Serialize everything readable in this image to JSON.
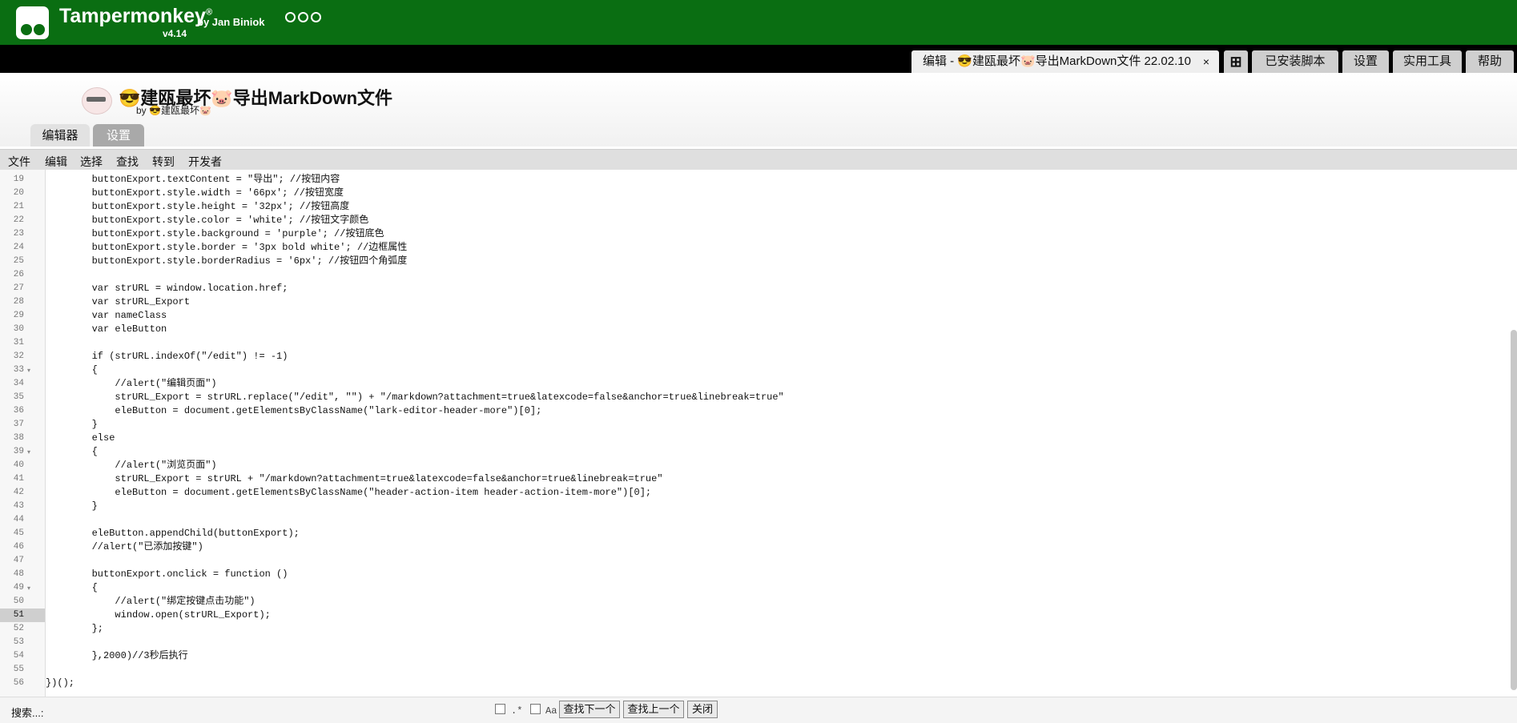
{
  "header": {
    "brand": "Tampermonkey",
    "registered": "®",
    "author": "by Jan Biniok",
    "version": "v4.14"
  },
  "tabs": {
    "editor_tab": "编辑 - 😎建瓯最坏🐷导出MarkDown文件 22.02.10",
    "close": "×",
    "plus": "⊞",
    "installed": "已安装脚本",
    "settings": "设置",
    "utilities": "实用工具",
    "help": "帮助"
  },
  "script": {
    "title": "😎建瓯最坏🐷导出MarkDown文件",
    "author": "by 😎建瓯最坏🐷"
  },
  "subtabs": {
    "editor": "编辑器",
    "settings": "设置"
  },
  "menu": {
    "file": "文件",
    "edit": "编辑",
    "select": "选择",
    "find": "查找",
    "goto": "转到",
    "developer": "开发者"
  },
  "code_lines": [
    {
      "n": 19,
      "text": "        buttonExport.textContent = \"导出\"; //按钮内容"
    },
    {
      "n": 20,
      "text": "        buttonExport.style.width = '66px'; //按钮宽度"
    },
    {
      "n": 21,
      "text": "        buttonExport.style.height = '32px'; //按钮高度"
    },
    {
      "n": 22,
      "text": "        buttonExport.style.color = 'white'; //按钮文字颜色"
    },
    {
      "n": 23,
      "text": "        buttonExport.style.background = 'purple'; //按钮底色"
    },
    {
      "n": 24,
      "text": "        buttonExport.style.border = '3px bold white'; //边框属性"
    },
    {
      "n": 25,
      "text": "        buttonExport.style.borderRadius = '6px'; //按钮四个角弧度"
    },
    {
      "n": 26,
      "text": ""
    },
    {
      "n": 27,
      "text": "        var strURL = window.location.href;"
    },
    {
      "n": 28,
      "text": "        var strURL_Export"
    },
    {
      "n": 29,
      "text": "        var nameClass"
    },
    {
      "n": 30,
      "text": "        var eleButton"
    },
    {
      "n": 31,
      "text": ""
    },
    {
      "n": 32,
      "text": "        if (strURL.indexOf(\"/edit\") != -1)"
    },
    {
      "n": 33,
      "text": "        {",
      "fold": true
    },
    {
      "n": 34,
      "text": "            //alert(\"编辑页面\")"
    },
    {
      "n": 35,
      "text": "            strURL_Export = strURL.replace(\"/edit\", \"\") + \"/markdown?attachment=true&latexcode=false&anchor=true&linebreak=true\""
    },
    {
      "n": 36,
      "text": "            eleButton = document.getElementsByClassName(\"lark-editor-header-more\")[0];"
    },
    {
      "n": 37,
      "text": "        }"
    },
    {
      "n": 38,
      "text": "        else"
    },
    {
      "n": 39,
      "text": "        {",
      "fold": true
    },
    {
      "n": 40,
      "text": "            //alert(\"浏览页面\")"
    },
    {
      "n": 41,
      "text": "            strURL_Export = strURL + \"/markdown?attachment=true&latexcode=false&anchor=true&linebreak=true\""
    },
    {
      "n": 42,
      "text": "            eleButton = document.getElementsByClassName(\"header-action-item header-action-item-more\")[0];"
    },
    {
      "n": 43,
      "text": "        }"
    },
    {
      "n": 44,
      "text": ""
    },
    {
      "n": 45,
      "text": "        eleButton.appendChild(buttonExport);"
    },
    {
      "n": 46,
      "text": "        //alert(\"已添加按键\")"
    },
    {
      "n": 47,
      "text": ""
    },
    {
      "n": 48,
      "text": "        buttonExport.onclick = function ()"
    },
    {
      "n": 49,
      "text": "        {",
      "fold": true
    },
    {
      "n": 50,
      "text": "            //alert(\"绑定按键点击功能\")"
    },
    {
      "n": 51,
      "text": "            window.open(strURL_Export);",
      "current": true
    },
    {
      "n": 52,
      "text": "        };"
    },
    {
      "n": 53,
      "text": ""
    },
    {
      "n": 54,
      "text": "        },2000)//3秒后执行"
    },
    {
      "n": 55,
      "text": ""
    },
    {
      "n": 56,
      "text": "})();"
    }
  ],
  "search": {
    "label": "搜索...:",
    "regex": ".*",
    "case": "Aa",
    "find_next": "查找下一个",
    "find_prev": "查找上一个",
    "close": "关闭"
  }
}
